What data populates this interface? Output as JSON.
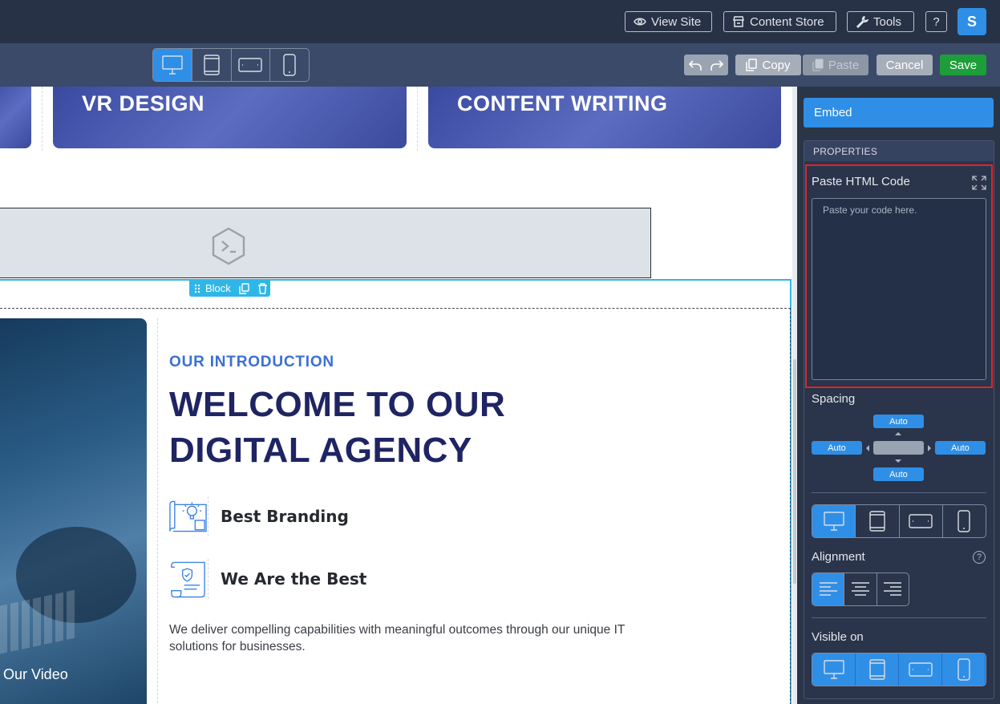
{
  "topbar": {
    "view_site": "View Site",
    "content_store": "Content Store",
    "tools": "Tools",
    "help": "?",
    "avatar": "S"
  },
  "toolbar": {
    "copy": "Copy",
    "paste": "Paste",
    "cancel": "Cancel",
    "save": "Save"
  },
  "canvas": {
    "cards": [
      "VR DESIGN",
      "CONTENT WRITING"
    ],
    "block_label": "Block",
    "video_label": "Our Video",
    "kicker": "OUR INTRODUCTION",
    "heading": "WELCOME TO OUR DIGITAL AGENCY",
    "features": [
      "Best Branding",
      "We Are the Best"
    ],
    "description": "We deliver compelling capabilities with meaningful outcomes through our unique IT solutions for businesses."
  },
  "panel": {
    "tab": "Embed",
    "properties": "PROPERTIES",
    "code_label": "Paste HTML Code",
    "code_placeholder": "Paste your code here.",
    "spacing_label": "Spacing",
    "spacing": {
      "top": "Auto",
      "left": "Auto",
      "right": "Auto",
      "bottom": "Auto"
    },
    "alignment_label": "Alignment",
    "visible_label": "Visible on"
  },
  "colors": {
    "accent": "#2f8fe6",
    "save": "#1e9e3a",
    "highlight": "#e0242b",
    "selection": "#2fb6e8"
  }
}
